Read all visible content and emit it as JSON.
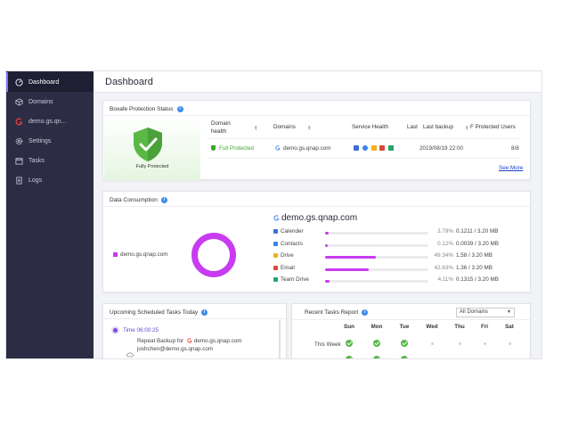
{
  "sidebar": {
    "items": [
      {
        "label": "Dashboard",
        "icon": "dashboard-icon"
      },
      {
        "label": "Domains",
        "icon": "cube-icon"
      },
      {
        "label": "demo.gs.qn...",
        "icon": "google-icon"
      },
      {
        "label": "Settings",
        "icon": "gear-icon"
      },
      {
        "label": "Tasks",
        "icon": "calendar-icon"
      },
      {
        "label": "Logs",
        "icon": "document-icon"
      }
    ]
  },
  "header": {
    "title": "Dashboard"
  },
  "protection": {
    "title": "Boxafe Protection Status",
    "shield_label": "Fully Protected",
    "columns": [
      "Domain health",
      "Domains",
      "Service Health",
      "Last",
      "Last backup",
      "F Protected Users"
    ],
    "row": {
      "health": "Full Protected",
      "domain": "demo.gs.qnap.com",
      "backup": "2019/08/19 22:00",
      "users": "8/8"
    },
    "see_more": "See More"
  },
  "consumption": {
    "title": "Data Consumption",
    "legend": "demo.gs.qnap.com",
    "domain_title": "demo.gs.qnap.com",
    "rows": [
      {
        "name": "Calender",
        "pct": "3.79%",
        "size": "0.1211 / 3.20 MB",
        "fill": 0.0379,
        "icon_color": "#3b6fd9"
      },
      {
        "name": "Contacts",
        "pct": "0.12%",
        "size": "0.0039 / 3.20 MB",
        "fill": 0.0012,
        "icon_color": "#3b82f0"
      },
      {
        "name": "Drive",
        "pct": "49.34%",
        "size": "1.58 / 3.20 MB",
        "fill": 0.4934,
        "icon_color": "#f2b01e"
      },
      {
        "name": "Email",
        "pct": "42.63%",
        "size": "1.36 / 3.20 MB",
        "fill": 0.4263,
        "icon_color": "#d84b3c"
      },
      {
        "name": "Team Drive",
        "pct": "4.11%",
        "size": "0.1315 / 3.20 MB",
        "fill": 0.0411,
        "icon_color": "#23a566"
      }
    ],
    "donut_color": "#c83bf0"
  },
  "upcoming": {
    "title": "Upcoming Scheduled Tasks Today",
    "time": "Time 06:00:25",
    "task": "Repeat Backup for",
    "task_domain": "demo.gs.qnap.com",
    "task_user": "joshchen@demo.gs.qnap.com"
  },
  "recent": {
    "title": "Recent Tasks Report",
    "filter": "All Domains",
    "days": [
      "Sun",
      "Mon",
      "Tue",
      "Wed",
      "Thu",
      "Fri",
      "Sat"
    ],
    "row_label": "This Week",
    "status": [
      "ok",
      "ok",
      "ok",
      "none",
      "none",
      "none",
      "none"
    ]
  }
}
